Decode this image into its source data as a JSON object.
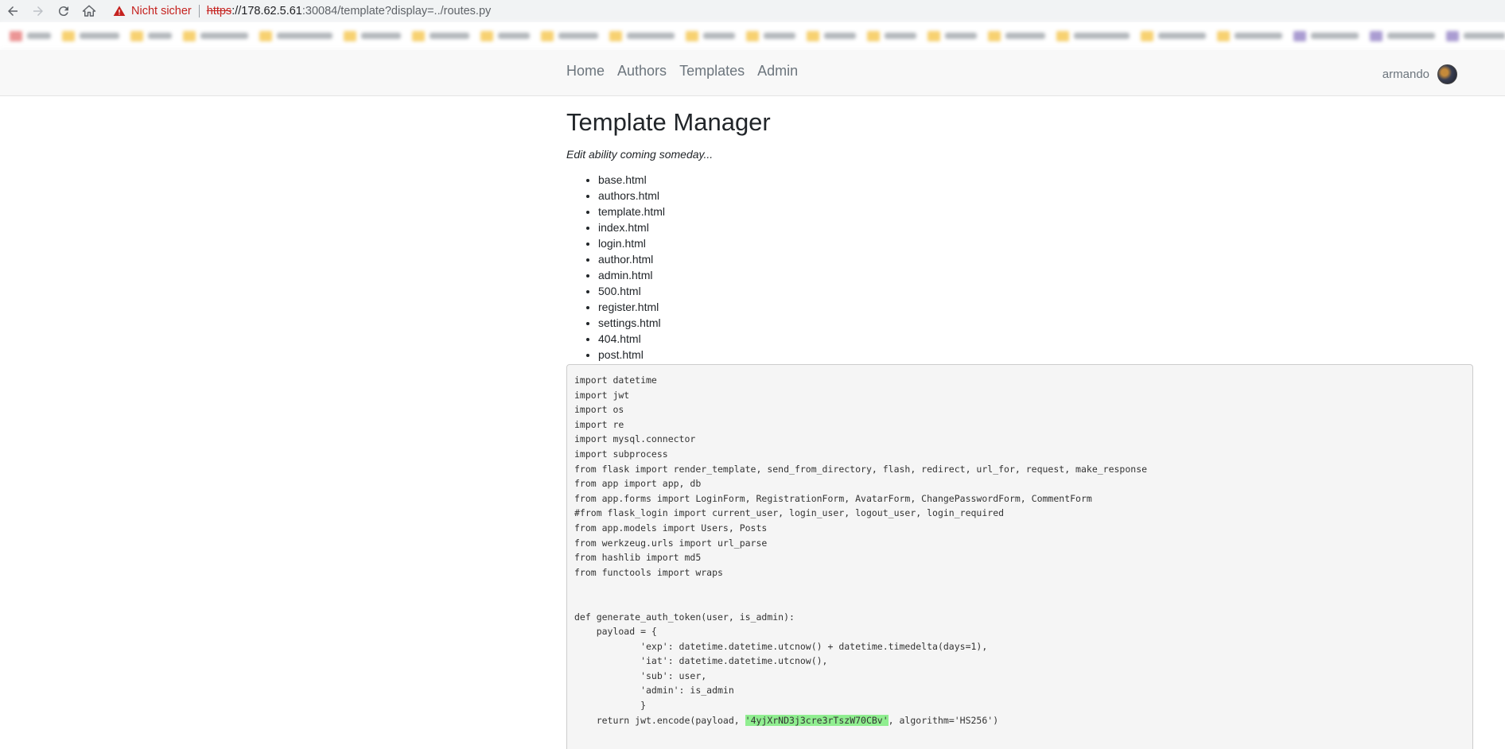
{
  "browser": {
    "security_label": "Nicht sicher",
    "url_scheme": "https",
    "url_host": "://178.62.5.61",
    "url_rest": ":30084/template?display=../routes.py",
    "bookmark_count": 22
  },
  "site_nav": {
    "links": [
      "Home",
      "Authors",
      "Templates",
      "Admin"
    ],
    "username": "armando"
  },
  "page": {
    "title": "Template Manager",
    "subtitle": "Edit ability coming someday...",
    "templates": [
      "base.html",
      "authors.html",
      "template.html",
      "index.html",
      "login.html",
      "author.html",
      "admin.html",
      "500.html",
      "register.html",
      "settings.html",
      "404.html",
      "post.html"
    ]
  },
  "code": {
    "lines": [
      "import datetime",
      "import jwt",
      "import os",
      "import re",
      "import mysql.connector",
      "import subprocess",
      "from flask import render_template, send_from_directory, flash, redirect, url_for, request, make_response",
      "from app import app, db",
      "from app.forms import LoginForm, RegistrationForm, AvatarForm, ChangePasswordForm, CommentForm",
      "#from flask_login import current_user, login_user, logout_user, login_required",
      "from app.models import Users, Posts",
      "from werkzeug.urls import url_parse",
      "from hashlib import md5",
      "from functools import wraps",
      "",
      "",
      "def generate_auth_token(user, is_admin):",
      "    payload = {",
      "            'exp': datetime.datetime.utcnow() + datetime.timedelta(days=1),",
      "            'iat': datetime.datetime.utcnow(),",
      "            'sub': user,",
      "            'admin': is_admin",
      "            }"
    ],
    "last_line_prefix": "    return jwt.encode(payload, ",
    "highlighted_secret": "'4yjXrND3j3cre3rTszW70CBv'",
    "last_line_suffix": ", algorithm='HS256')"
  }
}
